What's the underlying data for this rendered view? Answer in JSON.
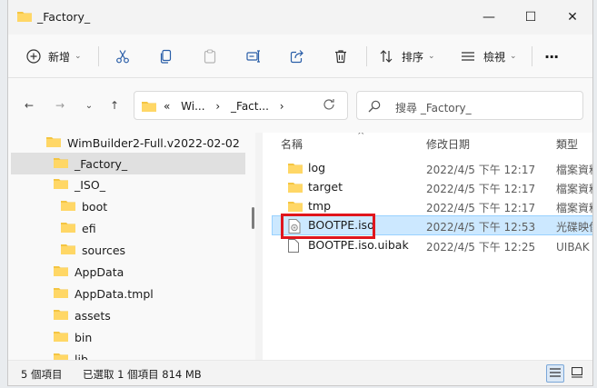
{
  "window": {
    "title": "_Factory_"
  },
  "controls": {
    "minimize": "—",
    "maximize": "☐",
    "close": "✕"
  },
  "toolbar": {
    "new_label": "新增",
    "sort_label": "排序",
    "view_label": "檢視",
    "more_label": "···"
  },
  "nav": {
    "back": "←",
    "forward": "→",
    "recent": "⌄",
    "up": "↑"
  },
  "address": {
    "overflow": "«",
    "crumbs": [
      "Wi...",
      "›",
      "_Fact...",
      "›"
    ]
  },
  "search": {
    "placeholder": "搜尋 _Factory_"
  },
  "tree": [
    {
      "label": "WimBuilder2-Full.v2022-02-02"
    },
    {
      "label": "_Factory_"
    },
    {
      "label": "_ISO_"
    },
    {
      "label": "boot"
    },
    {
      "label": "efi"
    },
    {
      "label": "sources"
    },
    {
      "label": "AppData"
    },
    {
      "label": "AppData.tmpl"
    },
    {
      "label": "assets"
    },
    {
      "label": "bin"
    },
    {
      "label": "lib"
    }
  ],
  "columns": {
    "name": "名稱",
    "date": "修改日期",
    "type": "類型"
  },
  "files": [
    {
      "name": "log",
      "date": "2022/4/5 下午 12:17",
      "type": "檔案資料"
    },
    {
      "name": "target",
      "date": "2022/4/5 下午 12:17",
      "type": "檔案資料"
    },
    {
      "name": "tmp",
      "date": "2022/4/5 下午 12:17",
      "type": "檔案資料"
    },
    {
      "name": "BOOTPE.iso",
      "date": "2022/4/5 下午 12:53",
      "type": "光碟映像"
    },
    {
      "name": "BOOTPE.iso.uibak",
      "date": "2022/4/5 下午 12:25",
      "type": "UIBAK 檔"
    }
  ],
  "status": {
    "count": "5 個項目",
    "selection": "已選取 1 個項目 814 MB"
  },
  "colors": {
    "folder": "#f4c542",
    "selection": "#cce8ff",
    "highlight": "#e0161d"
  }
}
